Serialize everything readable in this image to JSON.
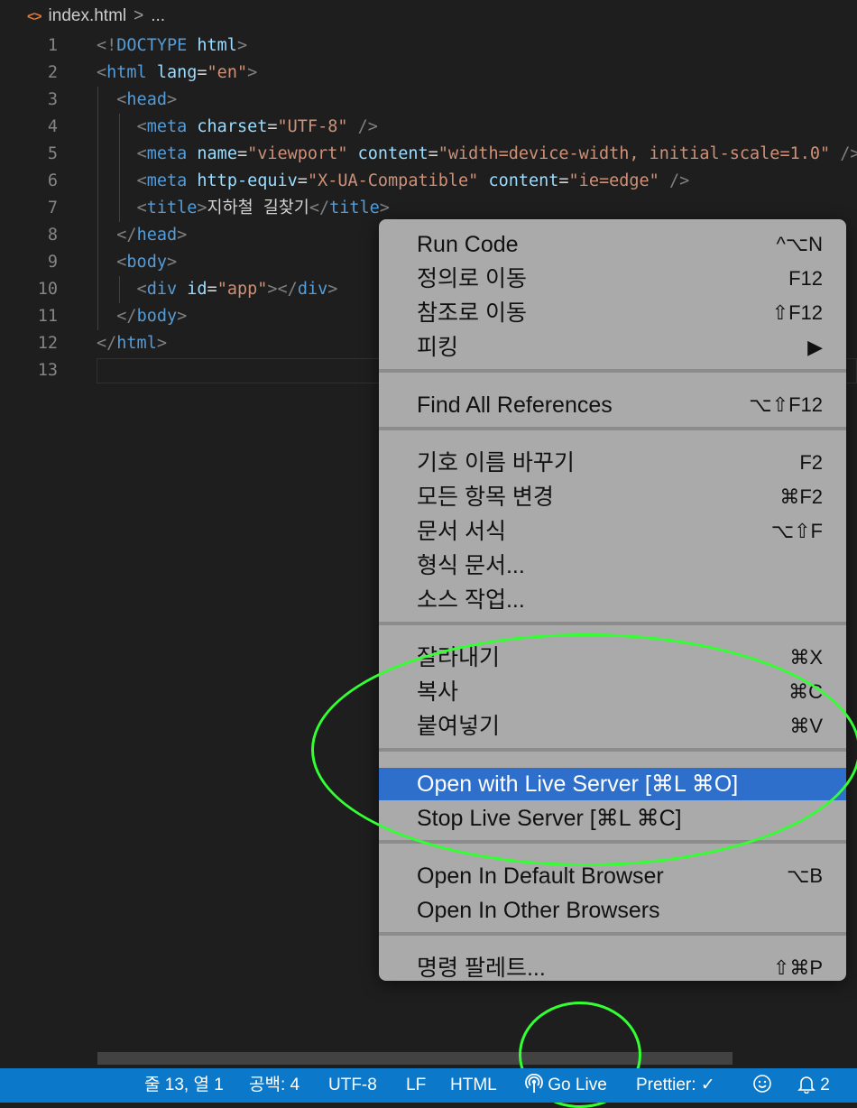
{
  "breadcrumb": {
    "file": "index.html",
    "separator": ">",
    "more": "..."
  },
  "editor": {
    "line_numbers": [
      "1",
      "2",
      "3",
      "4",
      "5",
      "6",
      "7",
      "8",
      "9",
      "10",
      "11",
      "12",
      "13"
    ],
    "lines": [
      [
        [
          "t-bracket",
          "<!"
        ],
        [
          "t-tag",
          "DOCTYPE"
        ],
        [
          "t-text",
          " "
        ],
        [
          "t-attr",
          "html"
        ],
        [
          "t-bracket",
          ">"
        ]
      ],
      [
        [
          "t-bracket",
          "<"
        ],
        [
          "t-tag",
          "html"
        ],
        [
          "t-text",
          " "
        ],
        [
          "t-attr",
          "lang"
        ],
        [
          "t-text",
          "="
        ],
        [
          "t-str",
          "\"en\""
        ],
        [
          "t-bracket",
          ">"
        ]
      ],
      [
        [
          "t-text",
          "  "
        ],
        [
          "t-bracket",
          "<"
        ],
        [
          "t-tag",
          "head"
        ],
        [
          "t-bracket",
          ">"
        ]
      ],
      [
        [
          "t-text",
          "    "
        ],
        [
          "t-bracket",
          "<"
        ],
        [
          "t-tag",
          "meta"
        ],
        [
          "t-text",
          " "
        ],
        [
          "t-attr",
          "charset"
        ],
        [
          "t-text",
          "="
        ],
        [
          "t-str",
          "\"UTF-8\""
        ],
        [
          "t-text",
          " "
        ],
        [
          "t-bracket",
          "/>"
        ]
      ],
      [
        [
          "t-text",
          "    "
        ],
        [
          "t-bracket",
          "<"
        ],
        [
          "t-tag",
          "meta"
        ],
        [
          "t-text",
          " "
        ],
        [
          "t-attr",
          "name"
        ],
        [
          "t-text",
          "="
        ],
        [
          "t-str",
          "\"viewport\""
        ],
        [
          "t-text",
          " "
        ],
        [
          "t-attr",
          "content"
        ],
        [
          "t-text",
          "="
        ],
        [
          "t-str",
          "\"width=device-width, initial-scale=1.0\""
        ],
        [
          "t-text",
          " "
        ],
        [
          "t-bracket",
          "/>"
        ]
      ],
      [
        [
          "t-text",
          "    "
        ],
        [
          "t-bracket",
          "<"
        ],
        [
          "t-tag",
          "meta"
        ],
        [
          "t-text",
          " "
        ],
        [
          "t-attr",
          "http-equiv"
        ],
        [
          "t-text",
          "="
        ],
        [
          "t-str",
          "\"X-UA-Compatible\""
        ],
        [
          "t-text",
          " "
        ],
        [
          "t-attr",
          "content"
        ],
        [
          "t-text",
          "="
        ],
        [
          "t-str",
          "\"ie=edge\""
        ],
        [
          "t-text",
          " "
        ],
        [
          "t-bracket",
          "/>"
        ]
      ],
      [
        [
          "t-text",
          "    "
        ],
        [
          "t-bracket",
          "<"
        ],
        [
          "t-tag",
          "title"
        ],
        [
          "t-bracket",
          ">"
        ],
        [
          "t-text",
          "지하철 길찾기"
        ],
        [
          "t-bracket",
          "</"
        ],
        [
          "t-tag",
          "title"
        ],
        [
          "t-bracket",
          ">"
        ]
      ],
      [
        [
          "t-text",
          "  "
        ],
        [
          "t-bracket",
          "</"
        ],
        [
          "t-tag",
          "head"
        ],
        [
          "t-bracket",
          ">"
        ]
      ],
      [
        [
          "t-text",
          "  "
        ],
        [
          "t-bracket",
          "<"
        ],
        [
          "t-tag",
          "body"
        ],
        [
          "t-bracket",
          ">"
        ]
      ],
      [
        [
          "t-text",
          "    "
        ],
        [
          "t-bracket",
          "<"
        ],
        [
          "t-tag",
          "div"
        ],
        [
          "t-text",
          " "
        ],
        [
          "t-attr",
          "id"
        ],
        [
          "t-text",
          "="
        ],
        [
          "t-str",
          "\"app\""
        ],
        [
          "t-bracket",
          "></"
        ],
        [
          "t-tag",
          "div"
        ],
        [
          "t-bracket",
          ">"
        ]
      ],
      [
        [
          "t-text",
          "  "
        ],
        [
          "t-bracket",
          "</"
        ],
        [
          "t-tag",
          "body"
        ],
        [
          "t-bracket",
          ">"
        ]
      ],
      [
        [
          "t-bracket",
          "</"
        ],
        [
          "t-tag",
          "html"
        ],
        [
          "t-bracket",
          ">"
        ]
      ],
      []
    ]
  },
  "context_menu": {
    "groups": [
      [
        {
          "label": "Run Code",
          "shortcut": "^⌥N"
        },
        {
          "label": "정의로 이동",
          "shortcut": "F12"
        },
        {
          "label": "참조로 이동",
          "shortcut": "⇧F12"
        },
        {
          "label": "피킹",
          "shortcut": "▶"
        }
      ],
      [
        {
          "label": "Find All References",
          "shortcut": "⌥⇧F12"
        }
      ],
      [
        {
          "label": "기호 이름 바꾸기",
          "shortcut": "F2"
        },
        {
          "label": "모든 항목 변경",
          "shortcut": "⌘F2"
        },
        {
          "label": "문서 서식",
          "shortcut": "⌥⇧F"
        },
        {
          "label": "형식 문서...",
          "shortcut": ""
        },
        {
          "label": "소스 작업...",
          "shortcut": ""
        }
      ],
      [
        {
          "label": "잘라내기",
          "shortcut": "⌘X"
        },
        {
          "label": "복사",
          "shortcut": "⌘C"
        },
        {
          "label": "붙여넣기",
          "shortcut": "⌘V"
        }
      ],
      [
        {
          "label": "Open with Live Server [⌘L ⌘O]",
          "shortcut": "",
          "selected": true
        },
        {
          "label": "Stop Live Server [⌘L ⌘C]",
          "shortcut": ""
        }
      ],
      [
        {
          "label": "Open In Default Browser",
          "shortcut": "⌥B"
        },
        {
          "label": "Open In Other Browsers",
          "shortcut": ""
        }
      ],
      [
        {
          "label": "명령 팔레트...",
          "shortcut": "⇧⌘P"
        }
      ]
    ]
  },
  "statusbar": {
    "position": "줄 13, 열 1",
    "spaces": "공백: 4",
    "encoding": "UTF-8",
    "eol": "LF",
    "language": "HTML",
    "go_live": "Go Live",
    "prettier": "Prettier: ✓",
    "notifications": "2"
  },
  "colors": {
    "accent_selected": "#2f6fcc",
    "statusbar": "#0c78c9",
    "annotation": "#33ff33"
  }
}
